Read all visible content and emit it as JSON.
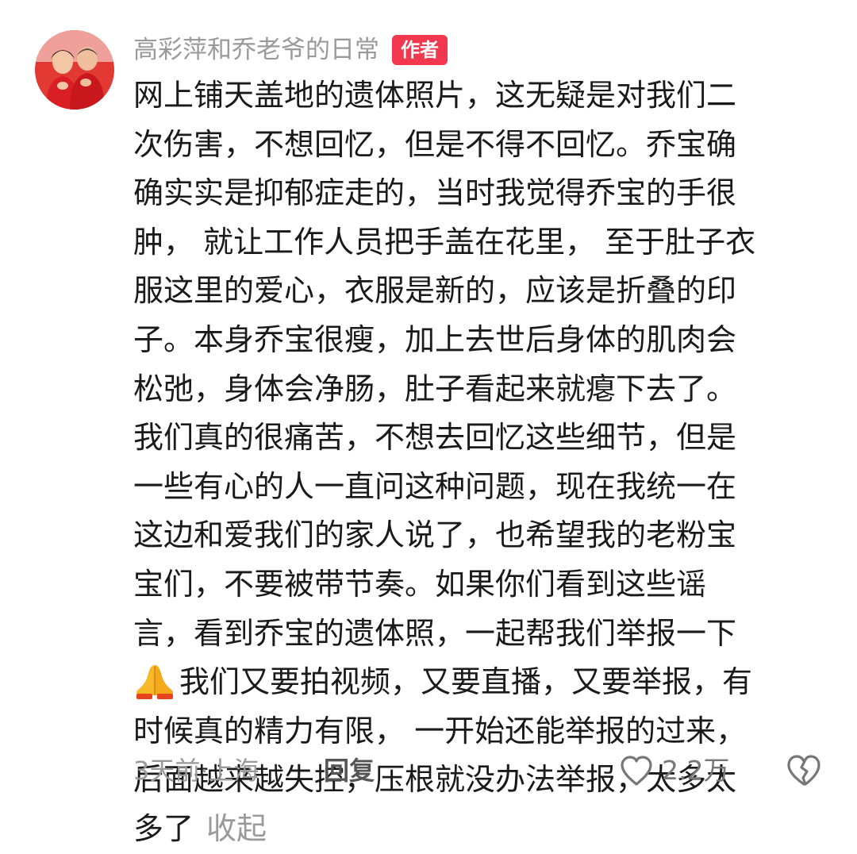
{
  "comment": {
    "username": "高彩萍和乔老爷的日常",
    "author_badge": "作者",
    "lines": [
      "网上铺天盖地的遗体照片，这无疑是对我们二",
      "次伤害，不想回忆，但是不得不回忆。乔宝确",
      "确实实是抑郁症走的，当时我觉得乔宝的手很",
      "肿， 就让工作人员把手盖在花里， 至于肚子衣",
      "服这里的爱心，衣服是新的，应该是折叠的印",
      "子。本身乔宝很瘦，加上去世后身体的肌肉会",
      "松弛，身体会净肠，肚子看起来就瘪下去了。",
      "我们真的很痛苦，不想去回忆这些细节，但是",
      "一些有心的人一直问这种问题，现在我统一在",
      "这边和爱我们的家人说了，也希望我的老粉宝",
      "宝们，不要被带节奏。如果你们看到这些谣",
      "言，看到乔宝的遗体照，一起帮我们举报一下"
    ],
    "emoji_line": "我们又要拍视频，又要直播，又要举报，有",
    "tail_lines": [
      "时候真的精力有限， 一开始还能举报的过来，",
      "后面越来越失控，压根就没办法举报，太多太"
    ],
    "last_line": "多了",
    "collapse_label": "收起",
    "emoji_icon": "folded-hands-icon",
    "meta": "3天前·上海",
    "reply_label": "回复",
    "like_count": "2.2万",
    "like_icon": "heart-outline-icon",
    "dislike_icon": "broken-heart-icon"
  },
  "colors": {
    "badge": "#f2384f",
    "muted_text": "#9a9a9a",
    "body_text": "#1a1a1a"
  }
}
